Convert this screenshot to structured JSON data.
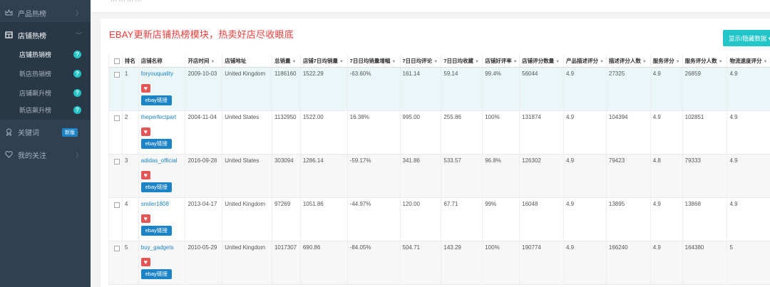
{
  "sidebar": {
    "items": [
      {
        "label": "产品热榜",
        "icon": "crown-icon"
      },
      {
        "label": "店铺热榜",
        "icon": "store-icon"
      },
      {
        "label": "关键词",
        "icon": "tag-icon",
        "badge": "新版"
      },
      {
        "label": "我的关注",
        "icon": "heart-icon"
      }
    ],
    "sub_items": [
      {
        "label": "店铺热销榜"
      },
      {
        "label": "新店热销榜"
      },
      {
        "label": "店铺飙升榜"
      },
      {
        "label": "新店飙升榜"
      }
    ],
    "help_mark": "?"
  },
  "topbar": {
    "breadcrumb": "⋯ ⋯ ⋯ ⋯"
  },
  "main": {
    "title": "EBAY更新店铺热榜模块，热卖好店尽收眼底",
    "column_button": "显示/隐藏数据 ▾"
  },
  "table": {
    "headers": [
      "排名",
      "店铺名称",
      "开店时间",
      "店铺地址",
      "总销量",
      "店铺7日均销量",
      "7日日均销量增幅",
      "7日日均评论",
      "7日日均收藏",
      "店铺好评率",
      "店铺评分数量",
      "产品描述评分",
      "描述评分人数",
      "服务评分",
      "服务评分人数",
      "物流速度评分"
    ],
    "link_label": "ebay链接",
    "rows": [
      {
        "rank": "1",
        "shop": "foryouquality",
        "open": "2009-10-03",
        "addr": "United Kingdom",
        "total": "1186160",
        "avg7": "1522.29",
        "growth": "-63.60%",
        "rev": "161.14",
        "fav": "59.14",
        "good": "99.4%",
        "scnt": "56044",
        "desc": "4.9",
        "dcnt": "27325",
        "svc": "4.9",
        "scnt2": "26859",
        "ship": "4.9"
      },
      {
        "rank": "2",
        "shop": "theperfectpart",
        "open": "2004-11-04",
        "addr": "United States",
        "total": "1132950",
        "avg7": "1522.00",
        "growth": "16.38%",
        "rev": "995.00",
        "fav": "255.86",
        "good": "100%",
        "scnt": "131874",
        "desc": "4.9",
        "dcnt": "104394",
        "svc": "4.9",
        "scnt2": "102851",
        "ship": "4.9"
      },
      {
        "rank": "3",
        "shop": "adidas_official",
        "open": "2016-09-28",
        "addr": "United States",
        "total": "303094",
        "avg7": "1286.14",
        "growth": "-59.17%",
        "rev": "341.86",
        "fav": "533.57",
        "good": "96.8%",
        "scnt": "126302",
        "desc": "4.9",
        "dcnt": "79423",
        "svc": "4.8",
        "scnt2": "79333",
        "ship": "4.9"
      },
      {
        "rank": "4",
        "shop": "smiler1808",
        "open": "2013-04-17",
        "addr": "United Kingdom",
        "total": "97269",
        "avg7": "1051.86",
        "growth": "-44.97%",
        "rev": "120.00",
        "fav": "67.71",
        "good": "99%",
        "scnt": "16048",
        "desc": "4.9",
        "dcnt": "13895",
        "svc": "4.9",
        "scnt2": "13868",
        "ship": "4.9"
      },
      {
        "rank": "5",
        "shop": "buy_gadgets",
        "open": "2010-05-29",
        "addr": "United Kingdom",
        "total": "1017307",
        "avg7": "690.86",
        "growth": "-84.05%",
        "rev": "504.71",
        "fav": "143.29",
        "good": "100%",
        "scnt": "190774",
        "desc": "4.9",
        "dcnt": "166240",
        "svc": "4.9",
        "scnt2": "164380",
        "ship": "5"
      }
    ]
  },
  "colors": {
    "sidebar": "#2f4050",
    "accent": "#23c6c8",
    "link": "#1c84c6",
    "title": "#ed3b3b",
    "heart": "#e45757"
  }
}
